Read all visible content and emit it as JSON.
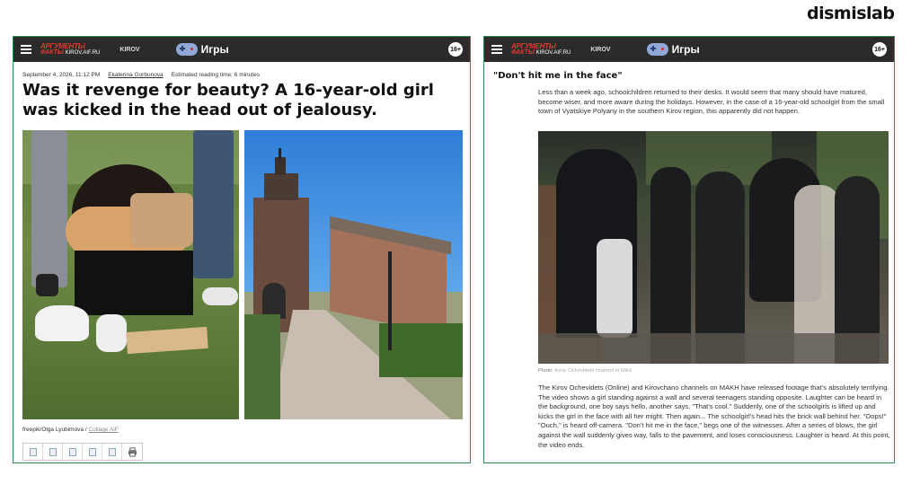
{
  "brand": "dismislab",
  "left_article": {
    "header": {
      "logo_line1": "АРГУМЕНТЫ",
      "logo_line2a": "ФАКТЫ",
      "logo_line2b": "KIROV.AIF.RU",
      "city": "KIROV",
      "games": "Игры",
      "age_rating": "16+"
    },
    "meta": {
      "date": "September 4, 2026, 11:12 PM",
      "author": "Ekaterina Gorbunova",
      "reading_time": "Estimated reading time: 6 minutes"
    },
    "headline": "Was it revenge for beauty? A 16-year-old girl was kicked in the head out of jealousy.",
    "caption_prefix": "freepik/Olga Lyubimova / ",
    "caption_link": "Collage AiF"
  },
  "right_article": {
    "header": {
      "logo_line1": "АРГУМЕНТЫ",
      "logo_line2a": "ФАКТЫ",
      "logo_line2b": "KIROV.AIF.RU",
      "city": "KIROV",
      "games": "Игры",
      "age_rating": "16+"
    },
    "section_title": "\"Don't hit me in the face\"",
    "intro": "Less than a week ago, schoolchildren returned to their desks. It would seem that many should have matured, become wiser, and more aware during the holidays. However, in the case of a 16-year-old schoolgirl from the small town of Vyatskiye Polyany in the southern Kirov region, this apparently did not happen.",
    "photo_label": "Photo: ",
    "photo_source": "Kirov Ochevidets channel in MAX",
    "body": "The Kirov Ochevidets (Online) and Kirovchano channels on MAKH have released footage that's absolutely terrifying. The video shows a girl standing against a wall and several teenagers standing opposite. Laughter can be heard in the background, one boy says hello, another says, \"That's cool.\" Suddenly, one of the schoolgirls is lifted up and kicks the girl in the face with all her might. Then again... The schoolgirl's head hits the brick wall behind her. \"Oops!\" \"Ouch,\" is heard off-camera. \"Don't hit me in the face,\" begs one of the witnesses. After a series of blows, the girl against the wall suddenly gives way, falls to the pavement, and loses consciousness. Laughter is heard. At this point, the video ends."
  }
}
